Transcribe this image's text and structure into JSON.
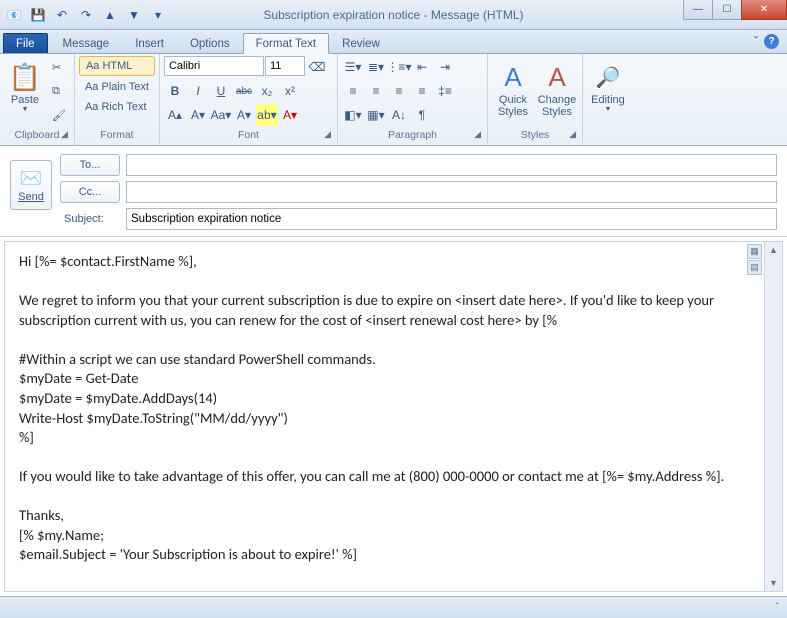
{
  "window": {
    "title": "Subscription expiration notice - Message (HTML)"
  },
  "qat": {
    "save": "💾",
    "undo": "↶",
    "redo": "↷",
    "prev": "▲",
    "next": "▼"
  },
  "tabs": {
    "file": "File",
    "items": [
      "Message",
      "Insert",
      "Options",
      "Format Text",
      "Review"
    ],
    "active": "Format Text"
  },
  "winbuttons": {
    "min": "—",
    "max": "☐",
    "close": "✕"
  },
  "ribbon": {
    "clipboard": {
      "label": "Clipboard",
      "paste": "Paste",
      "cut": "✂",
      "copy": "⧉",
      "painter": "🖌"
    },
    "format": {
      "label": "Format",
      "html": "Aa HTML",
      "plain": "Aa Plain Text",
      "rich": "Aa Rich Text"
    },
    "font": {
      "label": "Font",
      "name": "Calibri",
      "size": "11",
      "bold": "B",
      "italic": "I",
      "underline": "U",
      "strike": "abc",
      "sub": "x₂",
      "sup": "x²",
      "grow": "A▴",
      "shrink": "A▾",
      "case": "Aa▾",
      "effects": "A▾",
      "highlight": "ab▾",
      "color": "A▾"
    },
    "paragraph": {
      "label": "Paragraph"
    },
    "styles": {
      "label": "Styles",
      "quick": "Quick Styles",
      "change": "Change Styles"
    },
    "editing": {
      "label": "Editing",
      "find": "Editing"
    }
  },
  "compose": {
    "send": "Send",
    "to": "To...",
    "cc": "Cc...",
    "subject_label": "Subject:",
    "to_val": "",
    "cc_val": "",
    "subject_val": "Subscription expiration notice"
  },
  "body": "Hi [%= $contact.FirstName %],\n\nWe regret to inform you that your current subscription is due to expire on <insert date here>. If you'd like to keep your subscription current with us, you can renew for the cost of <insert renewal cost here> by [%\n\n#Within a script we can use standard PowerShell commands.\n$myDate = Get-Date\n$myDate = $myDate.AddDays(14)\nWrite-Host $myDate.ToString(\"MM/dd/yyyy\")\n%]\n\nIf you would like to take advantage of this offer, you can call me at (800) 000-0000 or contact me at [%= $my.Address %].\n\nThanks, \n[% $my.Name;\n$email.Subject = 'Your Subscription is about to expire!' %]",
  "status": {
    "expand": "ˇ"
  }
}
